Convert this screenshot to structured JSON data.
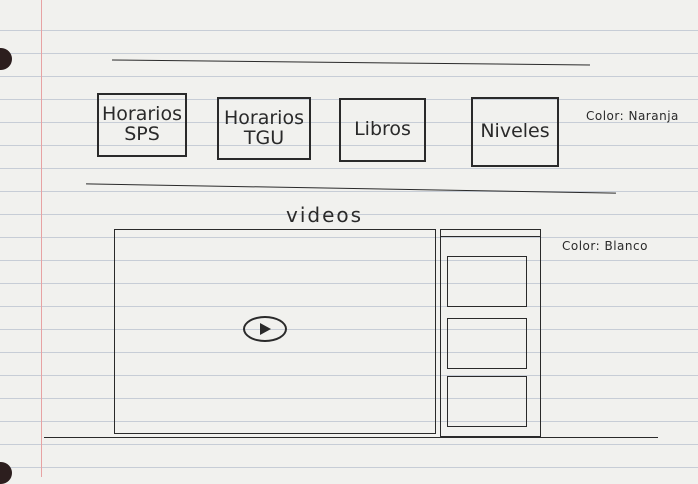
{
  "nav": {
    "items": [
      {
        "label": "Horarios\nSPS"
      },
      {
        "label": "Horarios\nTGU"
      },
      {
        "label": "Libros"
      },
      {
        "label": "Niveles"
      }
    ],
    "color_note": "Color: Naranja"
  },
  "videos": {
    "title": "videos",
    "color_note": "Color: Blanco",
    "playlist_count": 3
  },
  "colors": {
    "ink": "#2a2a2a",
    "paper": "#f1f1ee",
    "margin": "#e7a3a3"
  },
  "icons": [
    "play-icon"
  ]
}
